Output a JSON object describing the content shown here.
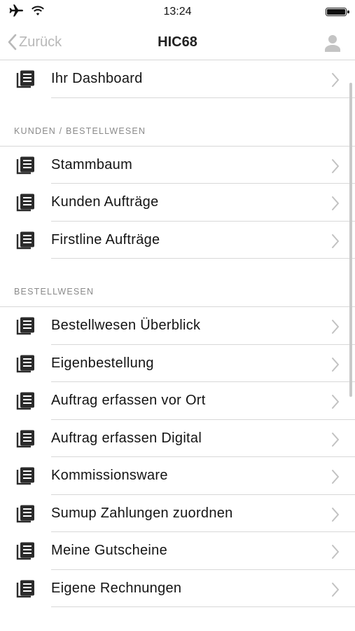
{
  "status_bar": {
    "time": "13:24"
  },
  "nav": {
    "back_label": "Zurück",
    "title": "HIC68"
  },
  "top_item": {
    "label": "Ihr Dashboard"
  },
  "sections": [
    {
      "header": "KUNDEN / BESTELLWESEN",
      "items": [
        "Stammbaum",
        "Kunden Aufträge",
        "Firstline Aufträge"
      ]
    },
    {
      "header": "BESTELLWESEN",
      "items": [
        "Bestellwesen Überblick",
        "Eigenbestellung",
        "Auftrag erfassen vor Ort",
        "Auftrag erfassen Digital",
        "Kommissionsware",
        "Sumup Zahlungen zuordnen",
        "Meine Gutscheine",
        "Eigene Rechnungen"
      ]
    }
  ]
}
